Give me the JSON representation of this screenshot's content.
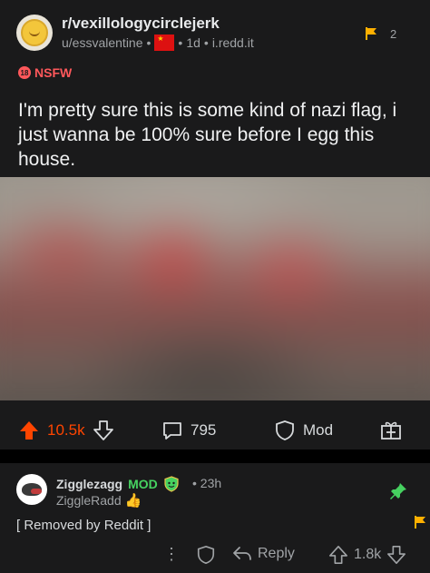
{
  "post": {
    "subreddit": "r/vexillologycirclejerk",
    "author": "u/essvalentine",
    "age": "1d",
    "domain": "i.redd.it",
    "report_count": "2",
    "nsfw_label": "NSFW",
    "nsfw_badge": "18",
    "title": "I'm pretty sure this is some kind of nazi flag, i just wanna be 100% sure before I egg this house.",
    "upvotes": "10.5k",
    "comments": "795",
    "mod_label": "Mod"
  },
  "comment": {
    "author": "Zigglezagg",
    "mod_tag": "MOD",
    "age": "23h",
    "flair": "ZiggleRadd",
    "body": "[ Removed by Reddit ]",
    "reply_label": "Reply",
    "score": "1.8k"
  },
  "colors": {
    "background": "#000000",
    "card": "#1a1a1b",
    "upvote_active": "#ff4500",
    "nsfw": "#ff585b",
    "mod_green": "#46d160",
    "report_flag": "#ffb000"
  }
}
